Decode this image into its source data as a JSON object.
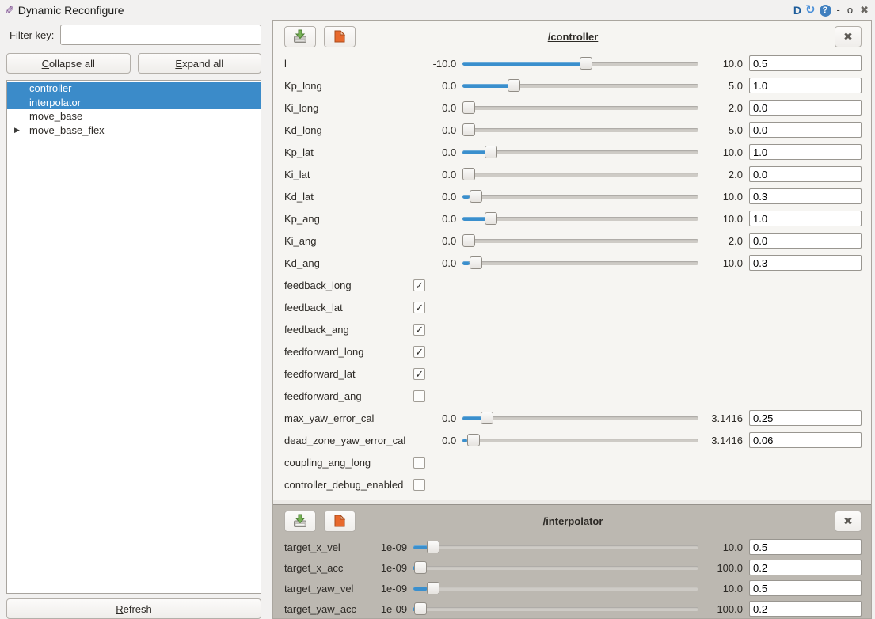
{
  "window": {
    "title": "Dynamic Reconfigure",
    "buttons": {
      "dock": "D",
      "reload": "↻",
      "help": "?",
      "minimize": "-",
      "restore": "o",
      "close": "✖"
    }
  },
  "icons": {
    "app": "pencil-document",
    "expander": "▶",
    "check": "✓",
    "group_close": "✖"
  },
  "sidebar": {
    "filter_label": "Filter key:",
    "filter_value": "",
    "collapse_all": "Collapse all",
    "expand_all": "Expand all",
    "refresh": "Refresh",
    "tree": [
      {
        "label": "controller",
        "selected": true,
        "expandable": false
      },
      {
        "label": "interpolator",
        "selected": true,
        "expandable": false
      },
      {
        "label": "move_base",
        "selected": false,
        "expandable": false
      },
      {
        "label": "move_base_flex",
        "selected": false,
        "expandable": true
      }
    ]
  },
  "groups": [
    {
      "title": "/controller",
      "variant": "light",
      "params": [
        {
          "name": "l",
          "type": "double",
          "min": "-10.0",
          "max": "10.0",
          "value": "0.5"
        },
        {
          "name": "Kp_long",
          "type": "double",
          "min": "0.0",
          "max": "5.0",
          "value": "1.0"
        },
        {
          "name": "Ki_long",
          "type": "double",
          "min": "0.0",
          "max": "2.0",
          "value": "0.0"
        },
        {
          "name": "Kd_long",
          "type": "double",
          "min": "0.0",
          "max": "5.0",
          "value": "0.0"
        },
        {
          "name": "Kp_lat",
          "type": "double",
          "min": "0.0",
          "max": "10.0",
          "value": "1.0"
        },
        {
          "name": "Ki_lat",
          "type": "double",
          "min": "0.0",
          "max": "2.0",
          "value": "0.0"
        },
        {
          "name": "Kd_lat",
          "type": "double",
          "min": "0.0",
          "max": "10.0",
          "value": "0.3"
        },
        {
          "name": "Kp_ang",
          "type": "double",
          "min": "0.0",
          "max": "10.0",
          "value": "1.0"
        },
        {
          "name": "Ki_ang",
          "type": "double",
          "min": "0.0",
          "max": "2.0",
          "value": "0.0"
        },
        {
          "name": "Kd_ang",
          "type": "double",
          "min": "0.0",
          "max": "10.0",
          "value": "0.3"
        },
        {
          "name": "feedback_long",
          "type": "bool",
          "checked": true
        },
        {
          "name": "feedback_lat",
          "type": "bool",
          "checked": true
        },
        {
          "name": "feedback_ang",
          "type": "bool",
          "checked": true
        },
        {
          "name": "feedforward_long",
          "type": "bool",
          "checked": true
        },
        {
          "name": "feedforward_lat",
          "type": "bool",
          "checked": true
        },
        {
          "name": "feedforward_ang",
          "type": "bool",
          "checked": false
        },
        {
          "name": "max_yaw_error_cal",
          "type": "double",
          "min": "0.0",
          "max": "3.1416",
          "value": "0.25"
        },
        {
          "name": "dead_zone_yaw_error_cal",
          "type": "double",
          "min": "0.0",
          "max": "3.1416",
          "value": "0.06"
        },
        {
          "name": "coupling_ang_long",
          "type": "bool",
          "checked": false
        },
        {
          "name": "controller_debug_enabled",
          "type": "bool",
          "checked": false
        }
      ]
    },
    {
      "title": "/interpolator",
      "variant": "gray",
      "params": [
        {
          "name": "target_x_vel",
          "type": "double",
          "min": "1e-09",
          "max": "10.0",
          "value": "0.5"
        },
        {
          "name": "target_x_acc",
          "type": "double",
          "min": "1e-09",
          "max": "100.0",
          "value": "0.2"
        },
        {
          "name": "target_yaw_vel",
          "type": "double",
          "min": "1e-09",
          "max": "10.0",
          "value": "0.5"
        },
        {
          "name": "target_yaw_acc",
          "type": "double",
          "min": "1e-09",
          "max": "100.0",
          "value": "0.2"
        }
      ]
    }
  ],
  "colors": {
    "selection_blue": "#3b8bc9",
    "slider_fill": "#3a8fcd",
    "group_light_bg": "#f6f5f2",
    "group_gray_bg": "#bcb8b1",
    "window_bg": "#f2f1f0"
  }
}
